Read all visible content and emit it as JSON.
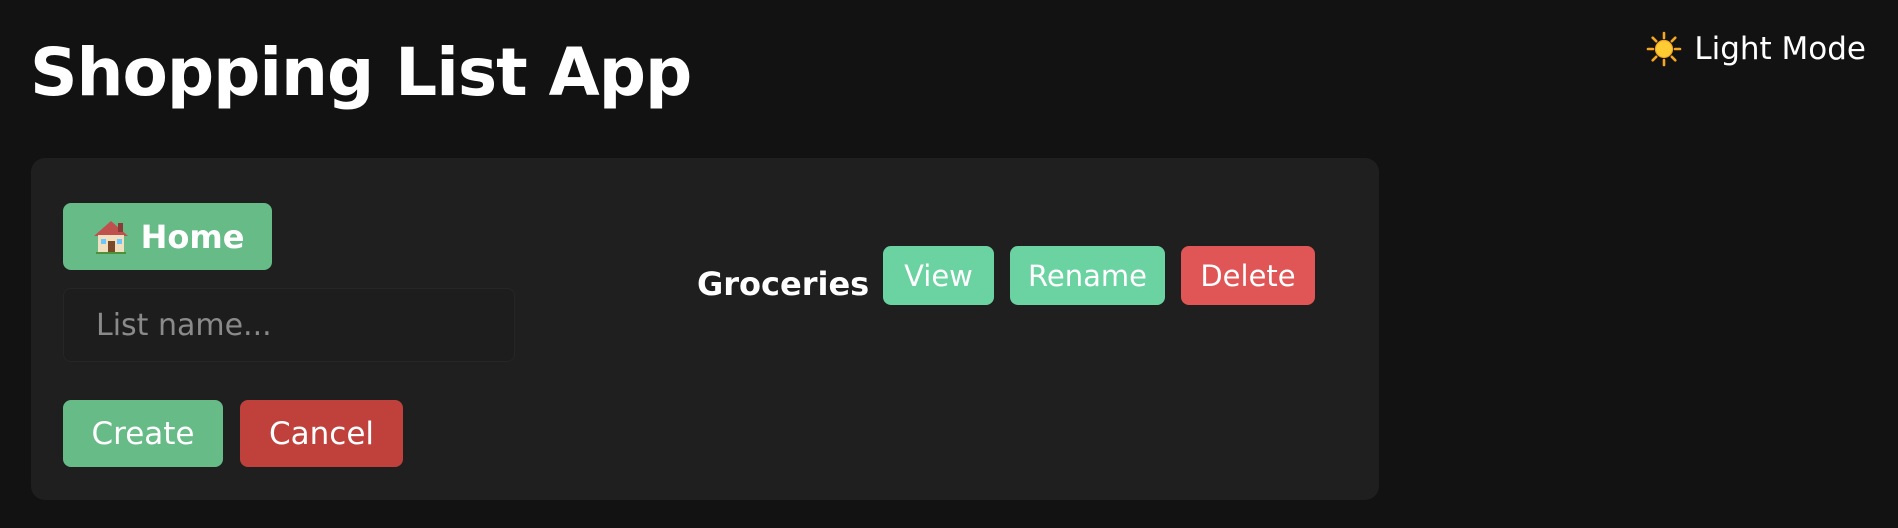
{
  "header": {
    "title": "Shopping List App",
    "theme_toggle_label": "Light Mode",
    "theme_icon": "sun-icon"
  },
  "panel": {
    "home_button_label": "Home",
    "home_icon": "house-icon",
    "list_name_placeholder": "List name...",
    "list_name_value": "",
    "create_label": "Create",
    "cancel_label": "Cancel",
    "lists": [
      {
        "name": "Groceries",
        "view_label": "View",
        "rename_label": "Rename",
        "delete_label": "Delete"
      }
    ]
  },
  "colors": {
    "background": "#121212",
    "panel": "#1f1f1f",
    "primary_green": "#66bb87",
    "light_green": "#6bd3a1",
    "cancel_red": "#c0413c",
    "delete_red": "#e05555"
  }
}
